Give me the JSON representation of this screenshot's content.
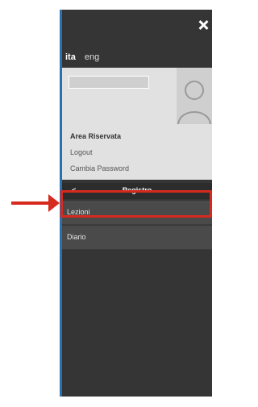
{
  "menu": {
    "close_label": "close",
    "lang_ita": "ita",
    "lang_eng": "eng",
    "user": {
      "area_title": "Area Riservata",
      "logout": "Logout",
      "change_password": "Cambia Password"
    },
    "registro": {
      "back_glyph": "<",
      "title": "Registro"
    },
    "items": [
      "Lezioni",
      "Diario"
    ]
  },
  "colors": {
    "panel_bg": "#353535",
    "accent_blue": "#2a6fb0",
    "highlight_red": "#d62a1f"
  },
  "icons": {
    "close": "close-icon",
    "avatar": "avatar-icon",
    "arrow": "arrow-right-icon"
  }
}
